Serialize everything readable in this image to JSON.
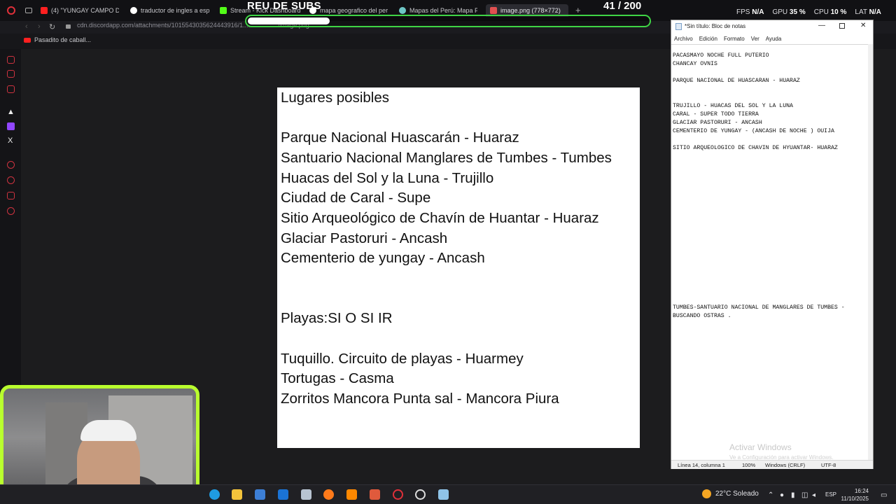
{
  "browser": {
    "tabs": [
      {
        "label": "(4) \"YUNGAY CAMPO DE",
        "icon": "youtube-icon",
        "color": "#ff2020"
      },
      {
        "label": "traductor de ingles a esp",
        "icon": "google-icon",
        "color": "#4285f4"
      },
      {
        "label": "Stream - Kick Dashboard",
        "icon": "kick-icon",
        "color": "#53fc18"
      },
      {
        "label": "mapa geografico del per",
        "icon": "google-icon",
        "color": "#4285f4"
      },
      {
        "label": "Mapas del Perú: Mapa P",
        "icon": "globe-icon",
        "color": "#6ec6c6"
      },
      {
        "label": "image.png (778×772)",
        "icon": "image-icon",
        "color": "#e05050"
      }
    ],
    "url": "cdn.discordapp.com/attachments/1015543035624443916/1..................../image.png",
    "bookmark": "Pasadito de caball..."
  },
  "overlay": {
    "title": "REU DE SUBS",
    "count": "41 / 200",
    "progress_fraction": 0.205
  },
  "hud": {
    "fps_label": "FPS",
    "fps_value": "N/A",
    "gpu_label": "GPU",
    "gpu_value": "35 %",
    "cpu_label": "CPU",
    "cpu_value": "10 %",
    "lat_label": "LAT",
    "lat_value": "N/A"
  },
  "image_doc": {
    "heading": "Lugares posibles",
    "places": [
      "Parque Nacional Huascarán - Huaraz",
      "Santuario Nacional Manglares de Tumbes - Tumbes",
      "Huacas del Sol y la Luna - Trujillo",
      "Ciudad de Caral - Supe",
      "Sitio Arqueológico de Chavín de Huantar - Huaraz",
      "Glaciar Pastoruri - Ancash",
      "Cementerio de yungay - Ancash"
    ],
    "beaches_heading": "Playas:SI O SI IR",
    "beaches": [
      "Tuquillo. Circuito de playas - Huarmey",
      "Tortugas - Casma",
      "Zorritos Mancora Punta sal - Mancora Piura"
    ]
  },
  "notepad": {
    "title": "*Sin título: Bloc de notas",
    "menu": [
      "Archivo",
      "Edición",
      "Formato",
      "Ver",
      "Ayuda"
    ],
    "lines": [
      "PACASMAYO NOCHE FULL PUTERIO",
      "CHANCAY OVNIS",
      "PARQUE NACIONAL DE HUASCARAN - HUARAZ",
      "TRUJILLO - HUACAS DEL SOL Y LA LUNA",
      "CARAL - SUPER TODO TIERRA",
      "GLACIAR PASTORURI - ANCASH",
      "CEMENTERIO DE YUNGAY - (ANCASH DE NOCHE ) OUIJA",
      "SITIO ARQUEOLOGICO DE CHAVIN DE HYUANTAR- HUARAZ",
      "TUMBES-SANTUARIO NACIONAL DE MANGLARES DE TUMBES -",
      "BUSCANDO OSTRAS ."
    ],
    "status": {
      "position": "Línea 14, columna 1",
      "zoom": "100%",
      "eol": "Windows (CRLF)",
      "encoding": "UTF-8"
    },
    "activate_title": "Activar Windows",
    "activate_sub": "Ve a Configuración para activar Windows."
  },
  "taskbar": {
    "weather": "22°C Soleado",
    "lang": "ESP",
    "time": "16:24",
    "date": "11/10/2025"
  }
}
